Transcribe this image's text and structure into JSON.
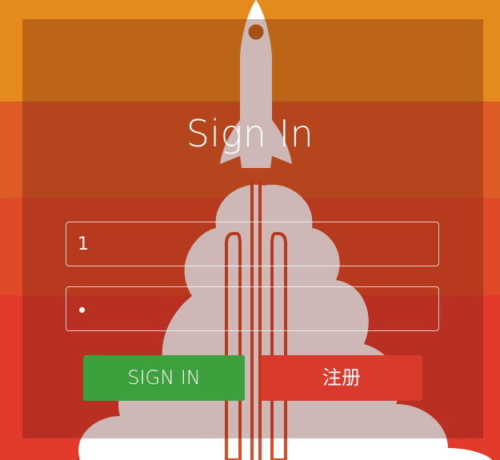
{
  "page": {
    "title": "Sign In"
  },
  "form": {
    "username_value": "1",
    "password_masked": "•"
  },
  "buttons": {
    "signin_label": "SIGN IN",
    "register_label": "注册"
  },
  "colors": {
    "band_top": "#e58a1c",
    "band_mid": "#dd5b26",
    "band_lower": "#e04b27",
    "band_bottom": "#e23b2c",
    "signin_green": "#3ca03c",
    "register_red": "#d93a2b"
  },
  "icons": {
    "background": "rocket-launch-illustration"
  }
}
